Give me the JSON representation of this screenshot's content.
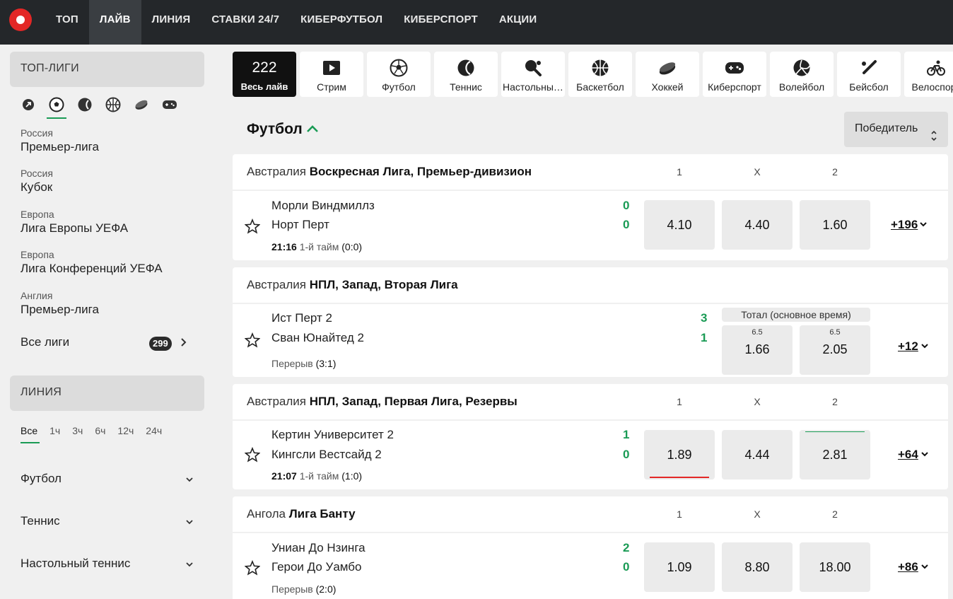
{
  "nav": {
    "items": [
      {
        "label": "ТОП",
        "active": false
      },
      {
        "label": "ЛАЙВ",
        "active": true
      },
      {
        "label": "ЛИНИЯ",
        "active": false
      },
      {
        "label": "СТАВКИ 24/7",
        "active": false
      },
      {
        "label": "КИБЕРФУТБОЛ",
        "active": false
      },
      {
        "label": "КИБЕРСПОРТ",
        "active": false
      },
      {
        "label": "АКЦИИ",
        "active": false
      }
    ]
  },
  "sidebar": {
    "top_leagues_title": "ТОП-ЛИГИ",
    "sport_icons": [
      "arrow-icon",
      "football-icon",
      "tennis-icon",
      "basketball-icon",
      "hockey-icon",
      "gamepad-icon"
    ],
    "leagues": [
      {
        "country": "Россия",
        "name": "Премьер-лига"
      },
      {
        "country": "Россия",
        "name": "Кубок"
      },
      {
        "country": "Европа",
        "name": "Лига Европы УЕФА"
      },
      {
        "country": "Европа",
        "name": "Лига Конференций УЕФА"
      },
      {
        "country": "Англия",
        "name": "Премьер-лига"
      }
    ],
    "all_leagues_label": "Все лиги",
    "all_leagues_count": "299",
    "line_title": "ЛИНИЯ",
    "time_tabs": [
      "Все",
      "1ч",
      "3ч",
      "6ч",
      "12ч",
      "24ч"
    ],
    "sports": [
      "Футбол",
      "Теннис",
      "Настольный теннис"
    ]
  },
  "sports_bar": {
    "live_count": "222",
    "live_label": "Весь лайв",
    "items": [
      {
        "label": "Стрим",
        "icon": "play-icon"
      },
      {
        "label": "Футбол",
        "icon": "football-icon"
      },
      {
        "label": "Теннис",
        "icon": "tennis-icon"
      },
      {
        "label": "Настольный теннис",
        "icon": "table-tennis-icon"
      },
      {
        "label": "Баскетбол",
        "icon": "basketball-icon"
      },
      {
        "label": "Хоккей",
        "icon": "hockey-icon"
      },
      {
        "label": "Киберспорт",
        "icon": "gamepad-icon"
      },
      {
        "label": "Волейбол",
        "icon": "volleyball-icon"
      },
      {
        "label": "Бейсбол",
        "icon": "baseball-icon"
      },
      {
        "label": "Велоспорт",
        "icon": "cycling-icon"
      }
    ]
  },
  "main": {
    "title": "Футбол",
    "sort_label": "Победитель",
    "cols": {
      "c1": "1",
      "cx": "X",
      "c2": "2"
    },
    "leagues": [
      {
        "country": "Австралия",
        "name": "Воскресная Лига, Премьер-дивизион",
        "event": {
          "team1": "Морли Виндмиллз",
          "team2": "Норт Перт",
          "score1": "0",
          "score2": "0",
          "time": "21:16",
          "period": "1-й тайм",
          "partial": "(0:0)",
          "odd1": "4.10",
          "oddx": "4.40",
          "odd2": "1.60",
          "more": "+196"
        }
      },
      {
        "country": "Австралия",
        "name": "НПЛ, Запад, Вторая Лига",
        "event": {
          "team1": "Ист Перт 2",
          "team2": "Сван Юнайтед 2",
          "score1": "3",
          "score2": "1",
          "period": "Перерыв",
          "partial": "(3:1)",
          "total_label": "Тотал (основное время)",
          "over_param": "6.5",
          "over": "1.66",
          "under_param": "6.5",
          "under": "2.05",
          "more": "+12"
        }
      },
      {
        "country": "Австралия",
        "name": "НПЛ, Запад, Первая Лига, Резервы",
        "event": {
          "team1": "Кертин Университет 2",
          "team2": "Кингсли Вестсайд 2",
          "score1": "1",
          "score2": "0",
          "time": "21:07",
          "period": "1-й тайм",
          "partial": "(1:0)",
          "odd1": "1.89",
          "oddx": "4.44",
          "odd2": "2.81",
          "more": "+64"
        }
      },
      {
        "country": "Ангола",
        "name": "Лига Банту",
        "event": {
          "team1": "Униан До Нзинга",
          "team2": "Герои До Уамбо",
          "score1": "2",
          "score2": "0",
          "period": "Перерыв",
          "partial": "(2:0)",
          "odd1": "1.09",
          "oddx": "8.80",
          "odd2": "18.00",
          "more": "+86"
        }
      }
    ]
  },
  "colors": {
    "accent_green": "#1a9b55",
    "brand_red": "#e32726",
    "topbar": "#24272a"
  }
}
